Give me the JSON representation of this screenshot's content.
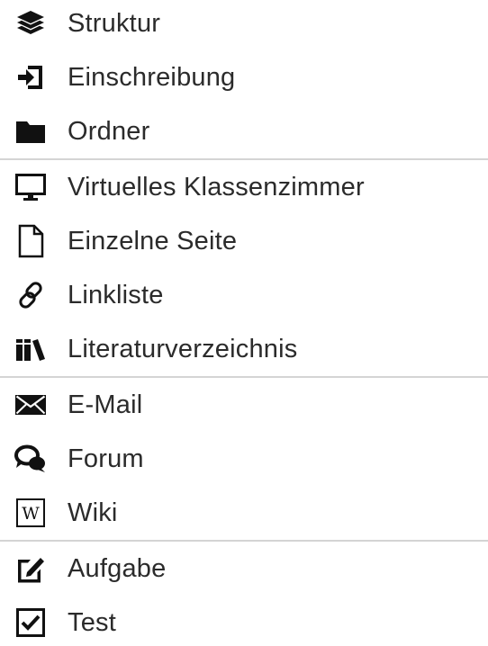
{
  "menu": {
    "groups": [
      {
        "items": [
          {
            "label": "Struktur",
            "icon": "layers-icon"
          },
          {
            "label": "Einschreibung",
            "icon": "sign-in-icon"
          },
          {
            "label": "Ordner",
            "icon": "folder-icon"
          }
        ]
      },
      {
        "items": [
          {
            "label": "Virtuelles Klassenzimmer",
            "icon": "monitor-icon"
          },
          {
            "label": "Einzelne Seite",
            "icon": "file-icon"
          },
          {
            "label": "Linkliste",
            "icon": "link-icon"
          },
          {
            "label": "Literaturverzeichnis",
            "icon": "books-icon"
          }
        ]
      },
      {
        "items": [
          {
            "label": "E-Mail",
            "icon": "envelope-icon"
          },
          {
            "label": "Forum",
            "icon": "comments-icon"
          },
          {
            "label": "Wiki",
            "icon": "wiki-icon"
          }
        ]
      },
      {
        "items": [
          {
            "label": "Aufgabe",
            "icon": "edit-icon"
          },
          {
            "label": "Test",
            "icon": "checkbox-icon"
          }
        ]
      }
    ]
  }
}
